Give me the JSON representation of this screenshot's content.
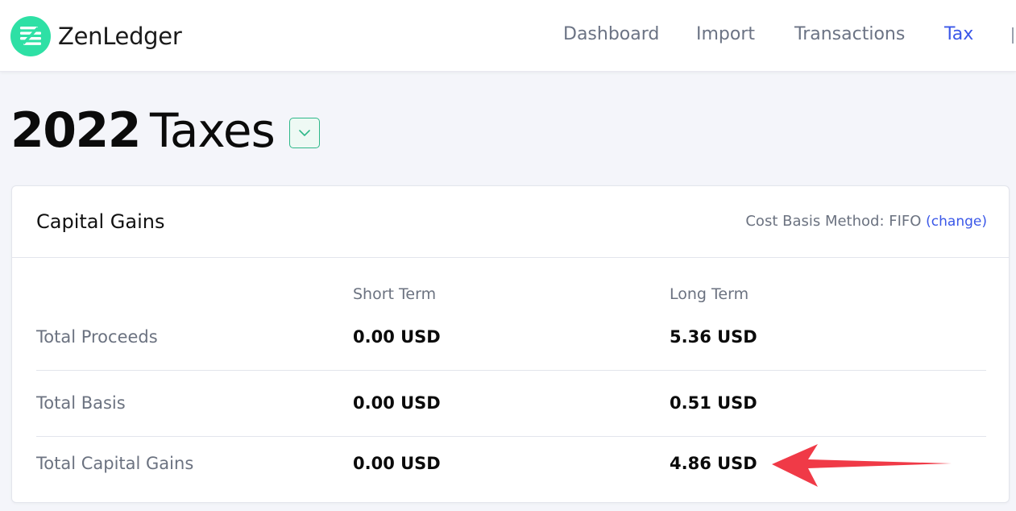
{
  "brand": {
    "name": "ZenLedger",
    "logo_icon": "zenledger-logo-icon",
    "color": "#2ee0a5"
  },
  "nav": {
    "items": [
      {
        "label": "Dashboard",
        "active": false
      },
      {
        "label": "Import",
        "active": false
      },
      {
        "label": "Transactions",
        "active": false
      },
      {
        "label": "Tax",
        "active": true
      },
      {
        "label": "",
        "active": false
      }
    ],
    "active_color": "#3a57e8"
  },
  "page": {
    "year": "2022",
    "title_word": "Taxes",
    "dropdown_icon": "chevron-down-icon"
  },
  "card": {
    "title": "Capital Gains",
    "cost_basis_label": "Cost Basis Method: FIFO",
    "change_link": "(change)",
    "columns": [
      "Short Term",
      "Long Term"
    ],
    "rows": [
      {
        "label": "Total Proceeds",
        "short_term": "0.00 USD",
        "long_term": "5.36 USD"
      },
      {
        "label": "Total Basis",
        "short_term": "0.00 USD",
        "long_term": "0.51 USD"
      },
      {
        "label": "Total Capital Gains",
        "short_term": "0.00 USD",
        "long_term": "4.86 USD"
      }
    ]
  },
  "annotation": {
    "icon": "red-arrow-annotation-icon",
    "color": "#f03a47"
  }
}
